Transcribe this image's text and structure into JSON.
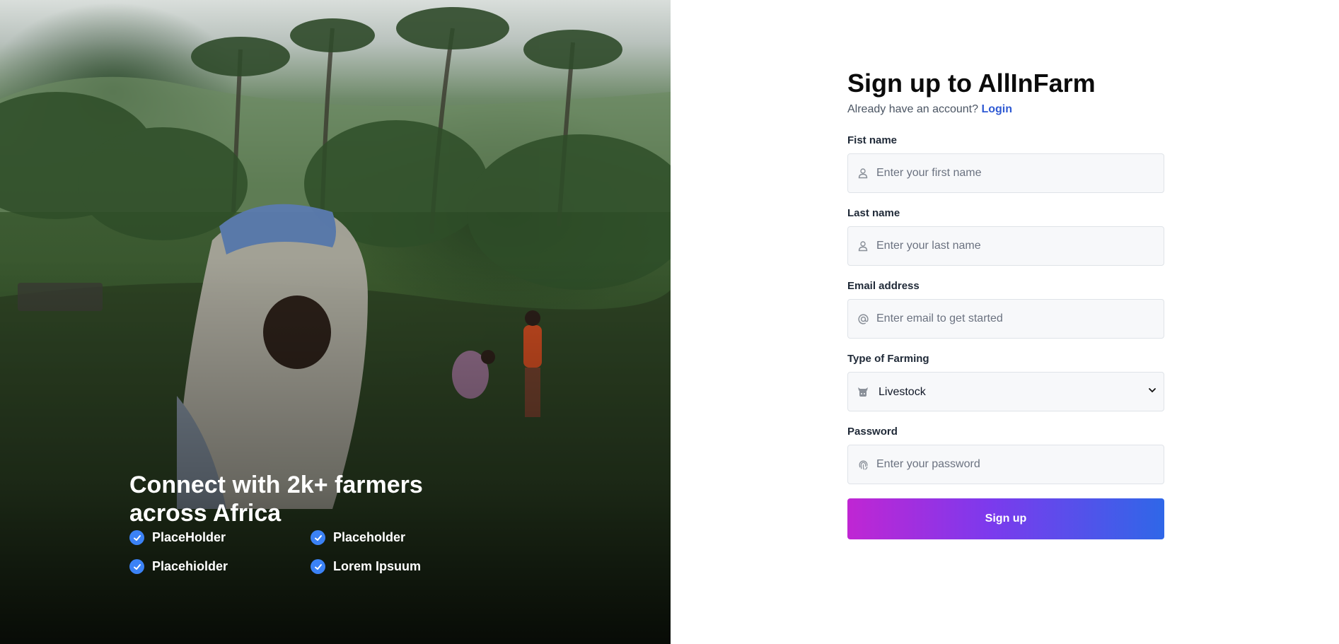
{
  "hero": {
    "title": "Connect with 2k+ farmers across Africa",
    "features": [
      "PlaceHolder",
      "Placeholder",
      "Placehiolder",
      "Lorem Ipsuum"
    ]
  },
  "form": {
    "title": "Sign up to AllInFarm",
    "subtitle": "Already have an account?",
    "login_link": "Login",
    "first_name": {
      "label": "Fist name",
      "placeholder": "Enter your first name",
      "icon": "user-icon"
    },
    "last_name": {
      "label": "Last name",
      "placeholder": "Enter your last name",
      "icon": "user-icon"
    },
    "email": {
      "label": "Email address",
      "placeholder": "Enter email to get started",
      "icon": "at-icon"
    },
    "farming": {
      "label": "Type of Farming",
      "selected": "Livestock",
      "icon": "cow-icon"
    },
    "password": {
      "label": "Password",
      "placeholder": "Enter your password",
      "icon": "fingerprint-icon"
    },
    "submit_label": "Sign up"
  },
  "colors": {
    "accent_blue": "#3b82f6",
    "link": "#2f5ad3",
    "button_gradient_start": "#c026d3",
    "button_gradient_end": "#2f67e8"
  }
}
